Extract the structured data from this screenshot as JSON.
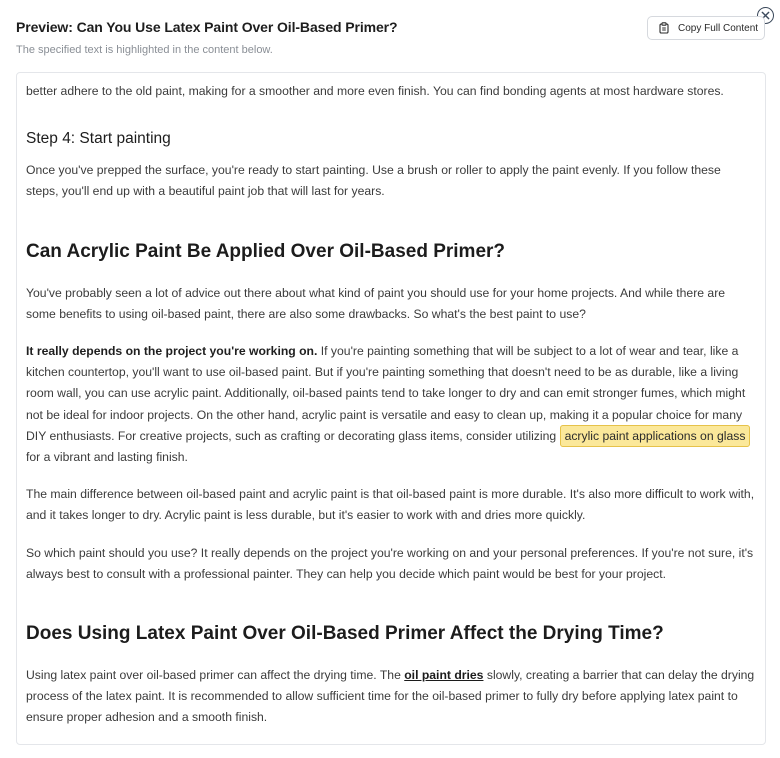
{
  "header": {
    "title": "Preview: Can You Use Latex Paint Over Oil-Based Primer?",
    "subtitle": "The specified text is highlighted in the content below.",
    "copy_label": "Copy Full Content"
  },
  "icons": {
    "close": "close-icon",
    "copy": "clipboard-icon"
  },
  "colors": {
    "highlight_bg": "#fbe89a",
    "highlight_border": "#e6c24a"
  },
  "content": {
    "p0": "better adhere to the old paint, making for a smoother and more even finish. You can find bonding agents at most hardware stores.",
    "step4_heading": "Step 4: Start painting",
    "p1": "Once you've prepped the surface, you're ready to start painting. Use a brush or roller to apply the paint evenly. If you follow these steps, you'll end up with a beautiful paint job that will last for years.",
    "h_acrylic": "Can Acrylic Paint Be Applied Over Oil-Based Primer?",
    "p2": "You've probably seen a lot of advice out there about what kind of paint you should use for your home projects. And while there are some benefits to using oil-based paint, there are also some drawbacks. So what's the best paint to use?",
    "p3_bold": "It really depends on the project you're working on.",
    "p3_text": " If you're painting something that will be subject to a lot of wear and tear, like a kitchen countertop, you'll want to use oil-based paint. But if you're painting something that doesn't need to be as durable, like a living room wall, you can use acrylic paint. Additionally, oil-based paints tend to take longer to dry and can emit stronger fumes, which might not be ideal for indoor projects. On the other hand, acrylic paint is versatile and easy to clean up, making it a popular choice for many DIY enthusiasts. For creative projects, such as crafting or decorating glass items, consider utilizing ",
    "p3_highlight": "acrylic paint applications on glass",
    "p3_after": " for a vibrant and lasting finish.",
    "p4": "The main difference between oil-based paint and acrylic paint is that oil-based paint is more durable. It's also more difficult to work with, and it takes longer to dry. Acrylic paint is less durable, but it's easier to work with and dries more quickly.",
    "p5": "So which paint should you use? It really depends on the project you're working on and your personal preferences. If you're not sure, it's always best to consult with a professional painter. They can help you decide which paint would be best for your project.",
    "h_drying": "Does Using Latex Paint Over Oil-Based Primer Affect the Drying Time?",
    "p6_before": "Using latex paint over oil-based primer can affect the drying time. The ",
    "p6_link": "oil paint dries",
    "p6_after": " slowly, creating a barrier that can delay the drying process of the latex paint. It is recommended to allow sufficient time for the oil-based primer to fully dry before applying latex paint to ensure proper adhesion and a smooth finish."
  }
}
